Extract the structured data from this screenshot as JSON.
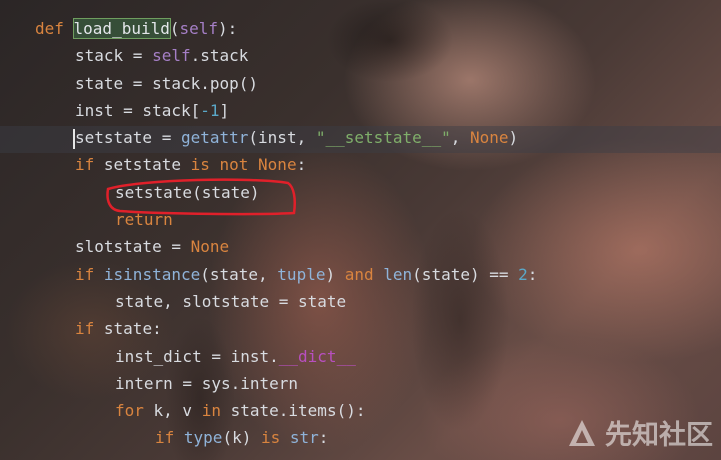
{
  "editor": {
    "lines": [
      {
        "indent": 0,
        "tokens": [
          {
            "t": "def ",
            "c": "kw"
          },
          {
            "t": "load_build",
            "c": "fn-hl"
          },
          {
            "t": "(",
            "c": "txt"
          },
          {
            "t": "self",
            "c": "self"
          },
          {
            "t": "):",
            "c": "txt"
          }
        ]
      },
      {
        "indent": 1,
        "tokens": [
          {
            "t": "stack = ",
            "c": "txt"
          },
          {
            "t": "self",
            "c": "self"
          },
          {
            "t": ".stack",
            "c": "txt"
          }
        ]
      },
      {
        "indent": 1,
        "tokens": [
          {
            "t": "state = stack.pop()",
            "c": "txt"
          }
        ]
      },
      {
        "indent": 1,
        "tokens": [
          {
            "t": "inst = stack[",
            "c": "txt"
          },
          {
            "t": "-1",
            "c": "num"
          },
          {
            "t": "]",
            "c": "txt"
          }
        ]
      },
      {
        "indent": 1,
        "caret": true,
        "tokens": [
          {
            "t": "setstate = ",
            "c": "txt"
          },
          {
            "t": "getattr",
            "c": "bi"
          },
          {
            "t": "(inst, ",
            "c": "txt"
          },
          {
            "t": "\"__setstate__\"",
            "c": "str"
          },
          {
            "t": ", ",
            "c": "txt"
          },
          {
            "t": "None",
            "c": "kw"
          },
          {
            "t": ")",
            "c": "txt"
          }
        ]
      },
      {
        "indent": 1,
        "tokens": [
          {
            "t": "if ",
            "c": "kw"
          },
          {
            "t": "setstate ",
            "c": "txt"
          },
          {
            "t": "is not None",
            "c": "kw"
          },
          {
            "t": ":",
            "c": "txt"
          }
        ]
      },
      {
        "indent": 2,
        "tokens": [
          {
            "t": "setstate(state)",
            "c": "txt"
          }
        ]
      },
      {
        "indent": 2,
        "tokens": [
          {
            "t": "return",
            "c": "kw"
          }
        ]
      },
      {
        "indent": 1,
        "tokens": [
          {
            "t": "slotstate = ",
            "c": "txt"
          },
          {
            "t": "None",
            "c": "kw"
          }
        ]
      },
      {
        "indent": 1,
        "tokens": [
          {
            "t": "if ",
            "c": "kw"
          },
          {
            "t": "isinstance",
            "c": "bi"
          },
          {
            "t": "(state, ",
            "c": "txt"
          },
          {
            "t": "tuple",
            "c": "bi"
          },
          {
            "t": ") ",
            "c": "txt"
          },
          {
            "t": "and ",
            "c": "kw"
          },
          {
            "t": "len",
            "c": "bi"
          },
          {
            "t": "(state) == ",
            "c": "txt"
          },
          {
            "t": "2",
            "c": "num"
          },
          {
            "t": ":",
            "c": "txt"
          }
        ]
      },
      {
        "indent": 2,
        "tokens": [
          {
            "t": "state, slotstate = state",
            "c": "txt"
          }
        ]
      },
      {
        "indent": 1,
        "tokens": [
          {
            "t": "if ",
            "c": "kw"
          },
          {
            "t": "state:",
            "c": "txt"
          }
        ]
      },
      {
        "indent": 2,
        "tokens": [
          {
            "t": "inst_dict = inst.",
            "c": "txt"
          },
          {
            "t": "__dict__",
            "c": "dunder"
          }
        ]
      },
      {
        "indent": 2,
        "tokens": [
          {
            "t": "intern = sys.intern",
            "c": "txt"
          }
        ]
      },
      {
        "indent": 2,
        "tokens": [
          {
            "t": "for ",
            "c": "kw"
          },
          {
            "t": "k, v ",
            "c": "txt"
          },
          {
            "t": "in ",
            "c": "kw"
          },
          {
            "t": "state.items():",
            "c": "txt"
          }
        ]
      },
      {
        "indent": 3,
        "tokens": [
          {
            "t": "if ",
            "c": "kw"
          },
          {
            "t": "type",
            "c": "bi"
          },
          {
            "t": "(k) ",
            "c": "txt"
          },
          {
            "t": "is ",
            "c": "kw"
          },
          {
            "t": "str",
            "c": "bi"
          },
          {
            "t": ":",
            "c": "txt"
          }
        ]
      }
    ]
  },
  "watermark": {
    "text": "先知社区",
    "icon": "xianzhi-logo-icon"
  },
  "annotation": {
    "color": "#e0202a",
    "target": "setstate(state)"
  }
}
